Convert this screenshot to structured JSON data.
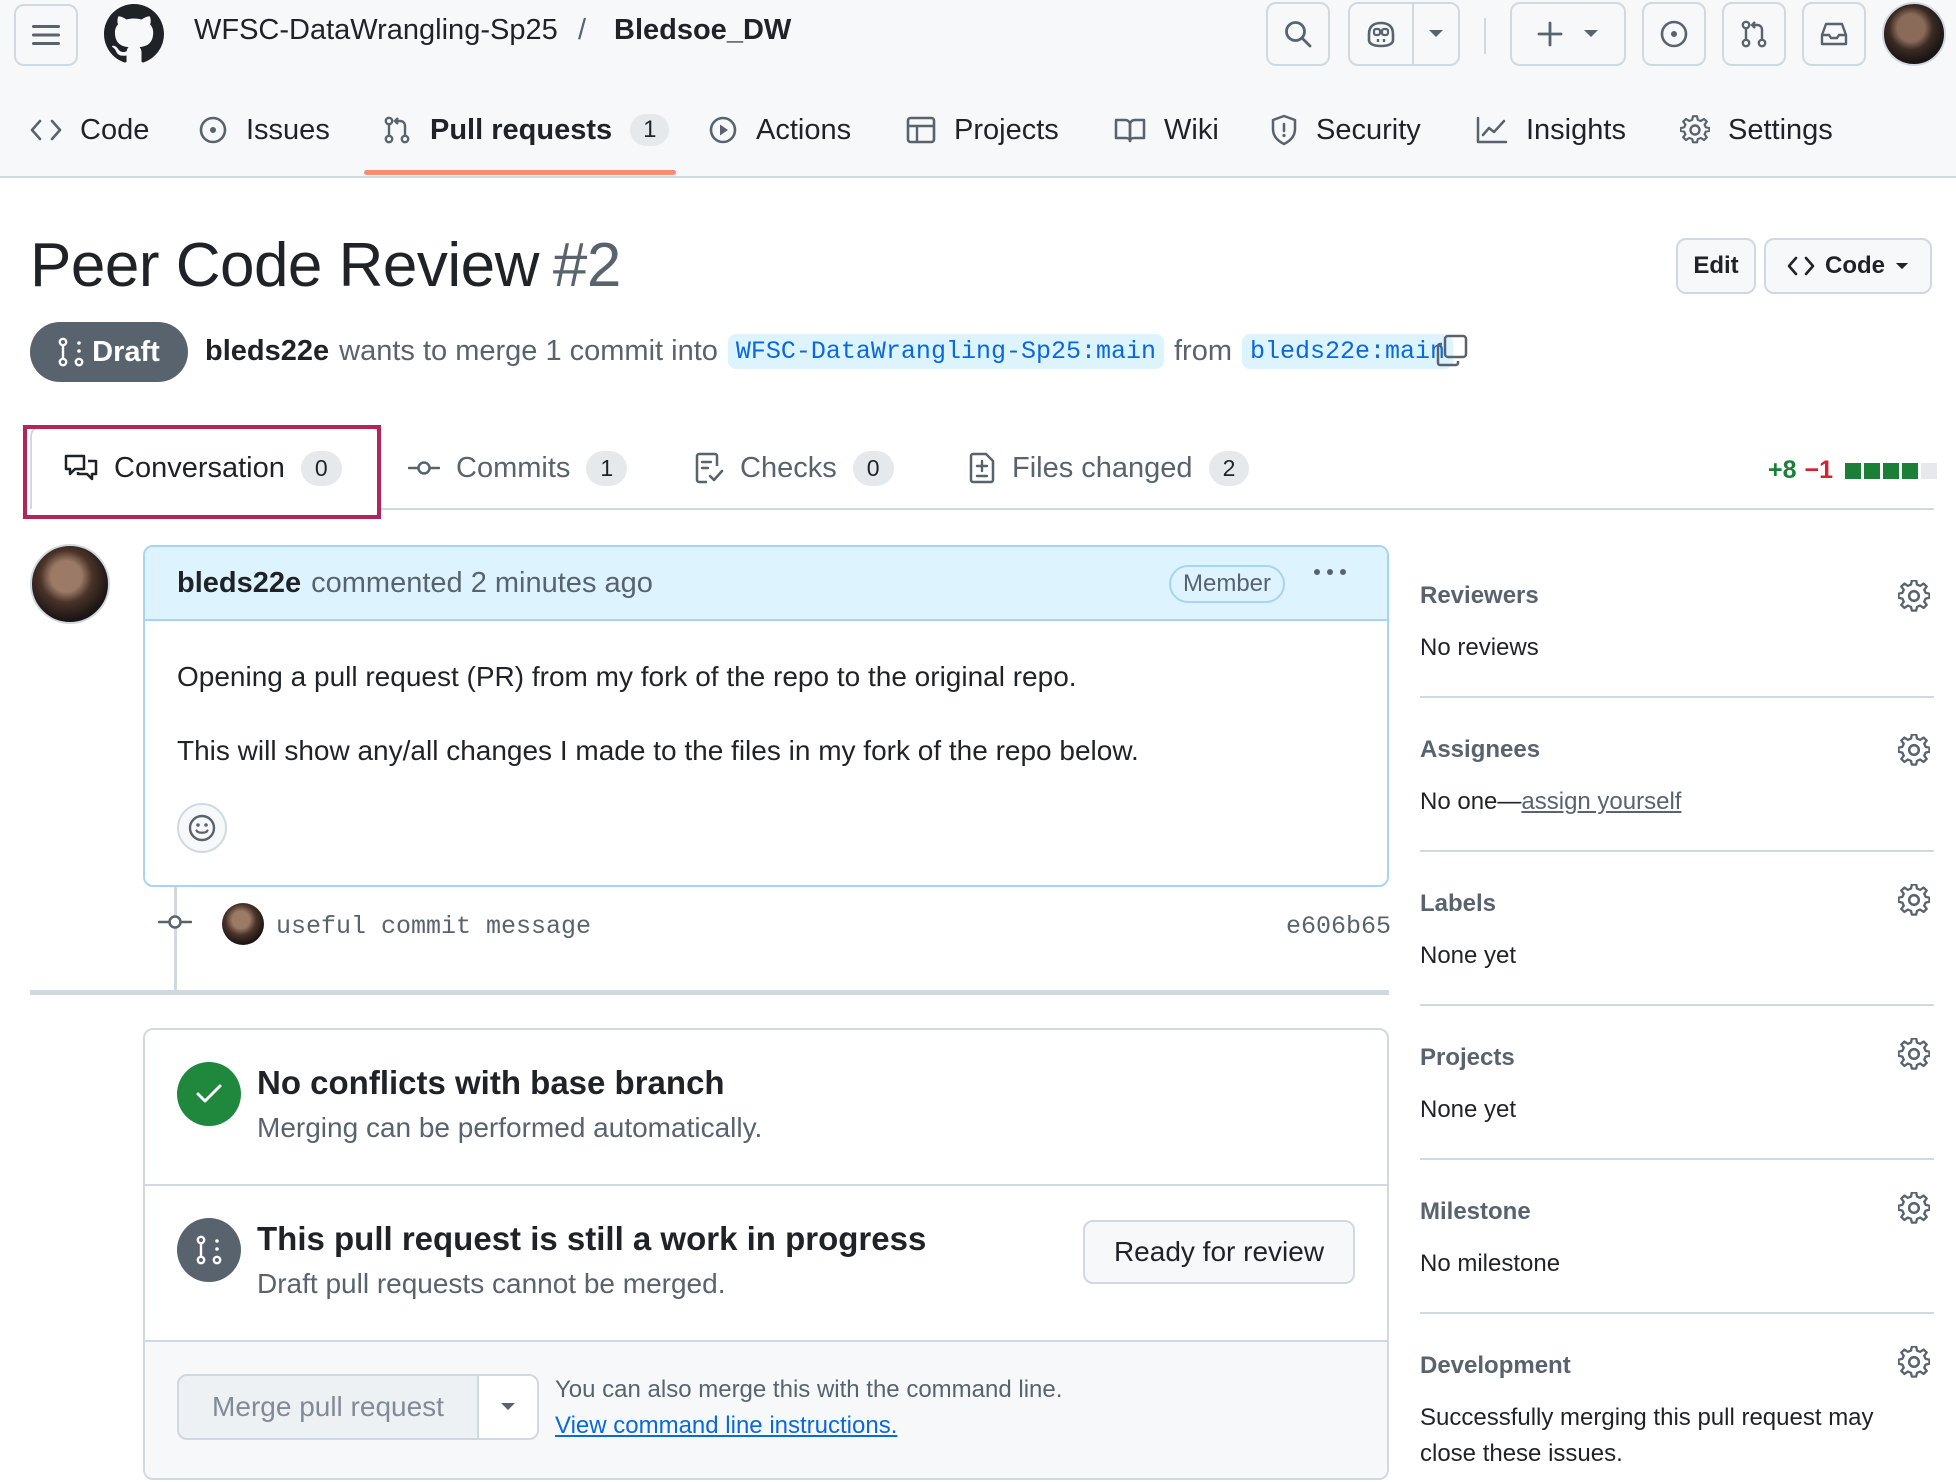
{
  "header": {
    "org": "WFSC-DataWrangling-Sp25",
    "separator": "/",
    "repo": "Bledsoe_DW",
    "icons": [
      "menu-icon",
      "github-logo",
      "search-icon",
      "copilot-icon",
      "plus-icon",
      "issue-icon",
      "pull-request-icon",
      "inbox-icon"
    ]
  },
  "nav": {
    "code": "Code",
    "issues": "Issues",
    "pull_requests": "Pull requests",
    "pull_requests_count": "1",
    "actions": "Actions",
    "projects": "Projects",
    "wiki": "Wiki",
    "security": "Security",
    "insights": "Insights",
    "settings": "Settings"
  },
  "pr": {
    "title": "Peer Code Review",
    "number": "#2",
    "edit_label": "Edit",
    "code_label": "Code",
    "state": "Draft",
    "author": "bleds22e",
    "merge_text_1": "wants to merge 1 commit into",
    "base_branch": "WFSC-DataWrangling-Sp25:main",
    "merge_text_2": "from",
    "head_branch": "bleds22e:main"
  },
  "tabs": {
    "conversation": "Conversation",
    "conversation_count": "0",
    "commits": "Commits",
    "commits_count": "1",
    "checks": "Checks",
    "checks_count": "0",
    "files_changed": "Files changed",
    "files_changed_count": "2",
    "additions": "+8",
    "deletions": "−1",
    "diff_blocks": 4,
    "highlight_color": "#b3245b"
  },
  "comment": {
    "author": "bleds22e",
    "action": "commented 2 minutes ago",
    "badge": "Member",
    "paragraphs": [
      "Opening a pull request (PR) from my fork of the repo to the original repo.",
      "This will show any/all changes I made to the files in my fork of the repo below."
    ]
  },
  "commit": {
    "message": "useful commit message",
    "sha": "e606b65"
  },
  "merge": {
    "conflicts_title": "No conflicts with base branch",
    "conflicts_sub": "Merging can be performed automatically.",
    "wip_title": "This pull request is still a work in progress",
    "wip_sub": "Draft pull requests cannot be merged.",
    "ready_button": "Ready for review",
    "merge_button": "Merge pull request",
    "cli_text": "You can also merge this with the command line.",
    "cli_link": "View command line instructions.",
    "success_color": "#1f883d",
    "draft_color": "#59636e"
  },
  "sidebar": {
    "reviewers_title": "Reviewers",
    "reviewers_value": "No reviews",
    "assignees_title": "Assignees",
    "assignees_prefix": "No one—",
    "assignees_link": "assign yourself",
    "labels_title": "Labels",
    "labels_value": "None yet",
    "projects_title": "Projects",
    "projects_value": "None yet",
    "milestone_title": "Milestone",
    "milestone_value": "No milestone",
    "development_title": "Development",
    "development_line1": "Successfully merging this pull request may",
    "development_line2": "close these issues."
  }
}
